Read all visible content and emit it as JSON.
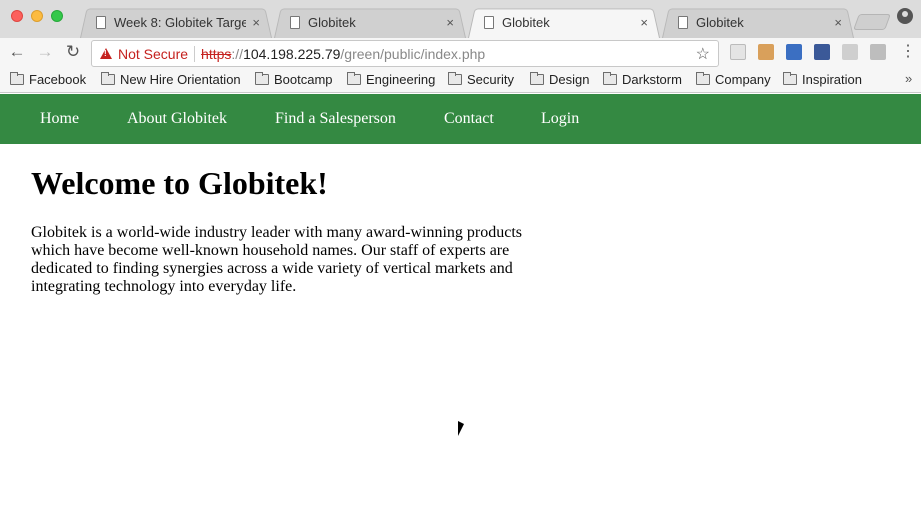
{
  "browser": {
    "tabs": [
      {
        "title": "Week 8: Globitek Targets",
        "close": "×",
        "active": false
      },
      {
        "title": "Globitek",
        "close": "×",
        "active": false
      },
      {
        "title": "Globitek",
        "close": "×",
        "active": true
      },
      {
        "title": "Globitek",
        "close": "×",
        "active": false
      }
    ],
    "toolbar": {
      "back": "←",
      "forward": "→",
      "reload": "↻",
      "security_label": "Not Secure",
      "url_scheme": "https",
      "url_sep": "://",
      "url_host": "104.198.225.79",
      "url_path": "/green/public/index.php",
      "star": "☆",
      "menu": "⋮"
    },
    "bookmarks": [
      {
        "label": "Facebook"
      },
      {
        "label": "New Hire Orientation"
      },
      {
        "label": "Bootcamp"
      },
      {
        "label": "Engineering"
      },
      {
        "label": "Security"
      },
      {
        "label": "Design"
      },
      {
        "label": "Darkstorm"
      },
      {
        "label": "Company"
      },
      {
        "label": "Inspiration"
      }
    ],
    "bookmarks_more": "»",
    "colors": {
      "nav_green": "#348942",
      "warning_red": "#c5221f"
    }
  },
  "site": {
    "nav": [
      "Home",
      "About Globitek",
      "Find a Salesperson",
      "Contact",
      "Login"
    ],
    "heading": "Welcome to Globitek!",
    "body": "Globitek is a world-wide industry leader with many award-winning products which have become well-known household names. Our staff of experts are dedicated to finding synergies across a wide variety of vertical markets and integrating technology into everyday life."
  }
}
